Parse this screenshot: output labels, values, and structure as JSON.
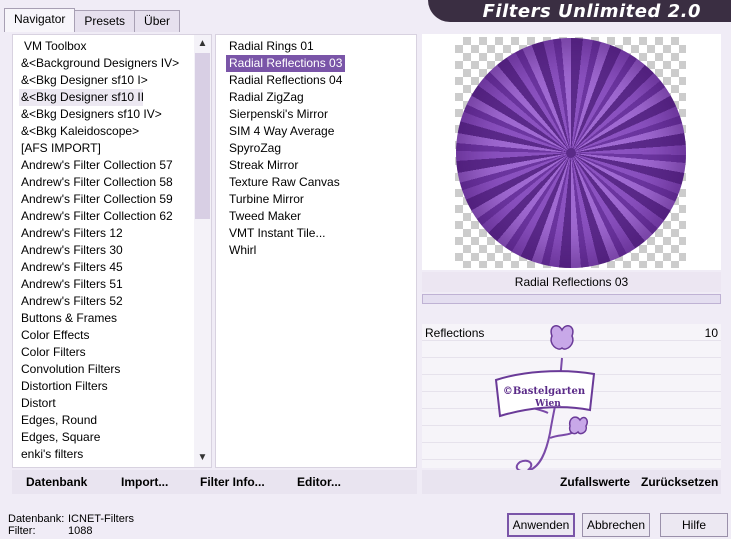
{
  "app": {
    "title": "Filters Unlimited 2.0"
  },
  "tabs": [
    {
      "label": "Navigator"
    },
    {
      "label": "Presets"
    },
    {
      "label": "Über"
    }
  ],
  "categories": [
    "VM Toolbox",
    "&<Background Designers IV>",
    "&<Bkg Designer sf10 I>",
    "&<Bkg Designer sf10 III>",
    "&<Bkg Designers sf10 IV>",
    "&<Bkg Kaleidoscope>",
    "[AFS IMPORT]",
    "Andrew's Filter Collection 57",
    "Andrew's Filter Collection 58",
    "Andrew's Filter Collection 59",
    "Andrew's Filter Collection 62",
    "Andrew's Filters 12",
    "Andrew's Filters 30",
    "Andrew's Filters 45",
    "Andrew's Filters 51",
    "Andrew's Filters 52",
    "Buttons & Frames",
    "Color Effects",
    "Color Filters",
    "Convolution Filters",
    "Distortion Filters",
    "Distort",
    "Edges, Round",
    "Edges, Square",
    "enki's filters"
  ],
  "filters": [
    "Radial  Rings 01",
    "Radial Reflections 03",
    "Radial Reflections 04",
    "Radial ZigZag",
    "Sierpenski's Mirror",
    "SIM 4 Way Average",
    "SpyroZag",
    "Streak Mirror",
    "Texture Raw Canvas",
    "Turbine Mirror",
    "Tweed Maker",
    "VMT Instant Tile...",
    "Whirl"
  ],
  "selected_filter": "Radial Reflections 03",
  "param": {
    "label": "Reflections",
    "value": "10"
  },
  "toolbar": {
    "datenbank": "Datenbank",
    "import": "Import...",
    "filter_info": "Filter Info...",
    "editor": "Editor..."
  },
  "right_toolbar": {
    "random": "Zufallswerte",
    "reset": "Zurücksetzen"
  },
  "status": {
    "db_label": "Datenbank:",
    "db_value": "ICNET-Filters",
    "filter_label": "Filter:",
    "filter_value": "1088"
  },
  "buttons": {
    "apply": "Anwenden",
    "cancel": "Abbrechen",
    "help": "Hilfe"
  },
  "watermark": {
    "line1": "©Bastelgarten",
    "line2": "Wien"
  },
  "colors": {
    "accent": "#7a55a8",
    "header": "#3a2e42"
  }
}
